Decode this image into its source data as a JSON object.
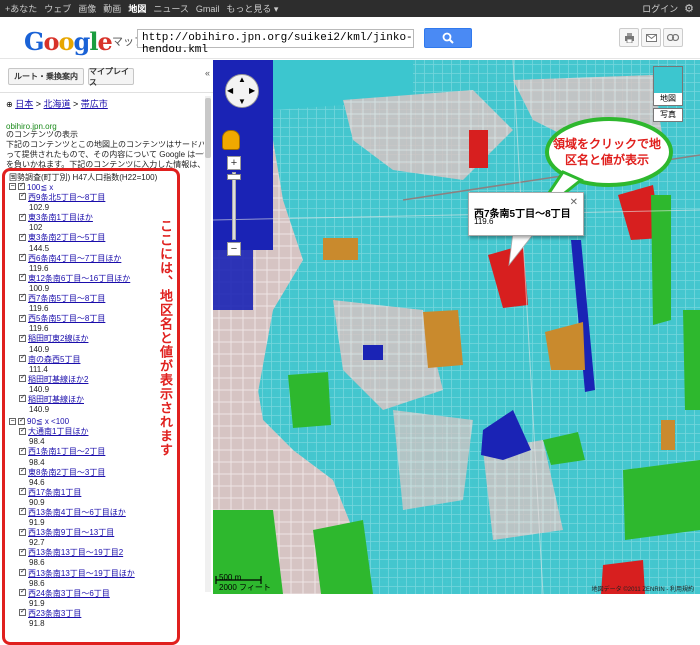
{
  "topbar": {
    "links": [
      "+あなた",
      "ウェブ",
      "画像",
      "動画",
      "地図",
      "ニュース",
      "Gmail",
      "もっと見る ▾"
    ],
    "active_index": 4,
    "login": "ログイン"
  },
  "header": {
    "logo": "Google",
    "product": "マップ",
    "search_value": "http://obihiro.jpn.org/suikei2/kml/jinko-hendou.kml"
  },
  "panel": {
    "route_button": "ルート・乗換案内",
    "myplaces_button": "マイプレイス",
    "breadcrumb": [
      "日本",
      "北海道",
      "帯広市"
    ],
    "site_link": "obihiro.jpn.org",
    "notice_lines": [
      "のコンテンツの表示",
      "下記のコンテンツとこの地図上のコンテンツはサードパーティによ",
      "って提供されたもので、その内容について Google は一切の責任",
      "を負いかねます。下記のコンテンツに入力した情報は、サードパー"
    ]
  },
  "legend": {
    "header": "国勢調査(町丁別) H47人口指数(H22=100)",
    "groups": [
      {
        "label": "100≦ x",
        "items": [
          {
            "name": "西9条北5丁目〜8丁目",
            "value": "102.9"
          },
          {
            "name": "東3条南1丁目ほか",
            "value": "102"
          },
          {
            "name": "東3条南2丁目〜5丁目",
            "value": "144.5"
          },
          {
            "name": "西6条南4丁目〜7丁目ほか",
            "value": "119.6"
          },
          {
            "name": "東12条南6丁目〜16丁目ほか",
            "value": "100.9"
          },
          {
            "name": "西7条南5丁目〜8丁目",
            "value": "119.6"
          },
          {
            "name": "西5条南5丁目〜8丁目",
            "value": "119.6"
          },
          {
            "name": "稲田町東2線ほか",
            "value": "140.9"
          },
          {
            "name": "南の森西5丁目",
            "value": "111.4"
          },
          {
            "name": "稲田町基線ほか2",
            "value": "140.9"
          },
          {
            "name": "稲田町基線ほか",
            "value": "140.9"
          }
        ]
      },
      {
        "label": "90≦ x <100",
        "items": [
          {
            "name": "大通南1丁目ほか",
            "value": "98.4"
          },
          {
            "name": "西1条南1丁目〜2丁目",
            "value": "98.4"
          },
          {
            "name": "東8条南2丁目〜3丁目",
            "value": "94.6"
          },
          {
            "name": "西17条南1丁目",
            "value": "90.9"
          },
          {
            "name": "西13条南4丁目〜6丁目ほか",
            "value": "91.9"
          },
          {
            "name": "西13条南9丁目〜13丁目",
            "value": "92.7"
          },
          {
            "name": "西13条南13丁目〜19丁目2",
            "value": "98.6"
          },
          {
            "name": "西13条南13丁目〜19丁目ほか",
            "value": "98.6"
          },
          {
            "name": "西24条南3丁目〜6丁目",
            "value": "91.9"
          },
          {
            "name": "西23条南3丁目",
            "value": "91.8"
          }
        ]
      }
    ],
    "annotation": "ここには、地区名と値が表示されます"
  },
  "map": {
    "type_buttons": [
      "地図",
      "写真"
    ],
    "info_title": "西7条南5丁目〜8丁目",
    "info_value": "119.6",
    "callout": "領域をクリックで地区名と値が表示",
    "scale_m": "500 m",
    "scale_ft": "2000 フィート",
    "copyright": "地図データ ©2011 ZENRIN - 利用規約",
    "colors": {
      "cyan": "#3cc6cf",
      "green": "#2eb82e",
      "blue": "#1a23b5",
      "red": "#d71f1f",
      "orange": "#c98a2d",
      "base": "#d9c9c7"
    }
  }
}
